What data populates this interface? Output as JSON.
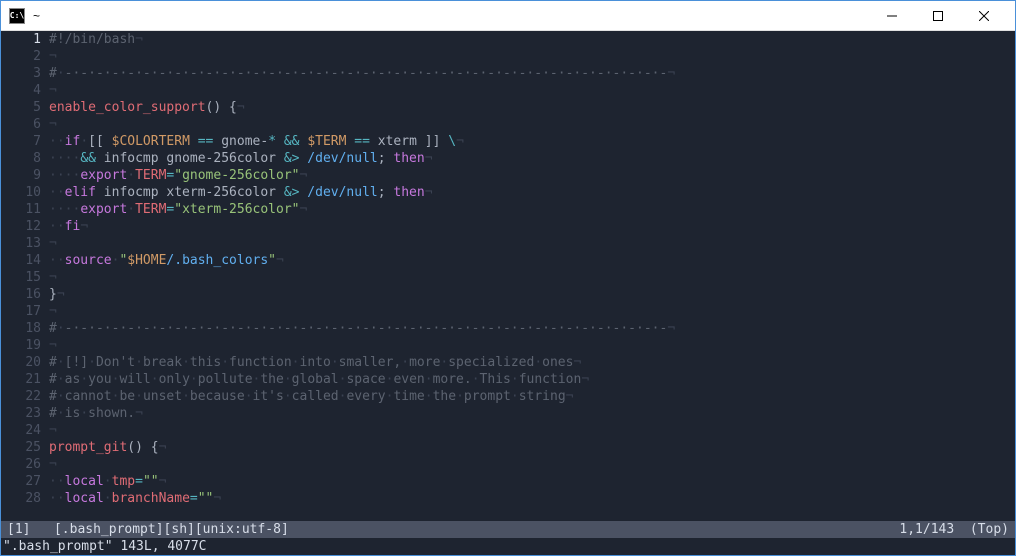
{
  "window": {
    "title": "~",
    "icon_label": "C:\\"
  },
  "gutter": {
    "current_line": 1,
    "total_visible": 28
  },
  "code": [
    [
      {
        "c": "comment",
        "t": "#!/bin/bash"
      },
      {
        "c": "ws",
        "t": "¬"
      }
    ],
    [
      {
        "c": "ws",
        "t": "¬"
      }
    ],
    [
      {
        "c": "comment",
        "t": "#"
      },
      {
        "c": "ws",
        "t": "·"
      },
      {
        "c": "comment",
        "t": "-·-·-·-·-·-·-·-·-·-·-·-·-·-·-·-·-·-·-·-·-·-·-·-·-·-·-·-·-·-·-·-·-·-·-·-·-·-·-"
      },
      {
        "c": "ws",
        "t": "¬"
      }
    ],
    [
      {
        "c": "ws",
        "t": "¬"
      }
    ],
    [
      {
        "c": "func",
        "t": "enable_color_support"
      },
      {
        "c": "punct",
        "t": "() {"
      },
      {
        "c": "ws",
        "t": "¬"
      }
    ],
    [
      {
        "c": "ws",
        "t": "¬"
      }
    ],
    [
      {
        "c": "ws",
        "t": "··"
      },
      {
        "c": "keyword",
        "t": "if"
      },
      {
        "c": "ws",
        "t": "·"
      },
      {
        "c": "punct",
        "t": "[[ "
      },
      {
        "c": "var",
        "t": "$COLORTERM"
      },
      {
        "c": "punct",
        "t": " "
      },
      {
        "c": "op",
        "t": "=="
      },
      {
        "c": "punct",
        "t": " gnome-"
      },
      {
        "c": "op",
        "t": "*"
      },
      {
        "c": "punct",
        "t": " "
      },
      {
        "c": "op",
        "t": "&&"
      },
      {
        "c": "punct",
        "t": " "
      },
      {
        "c": "var",
        "t": "$TERM"
      },
      {
        "c": "punct",
        "t": " "
      },
      {
        "c": "op",
        "t": "=="
      },
      {
        "c": "punct",
        "t": " xterm ]] "
      },
      {
        "c": "op",
        "t": "\\"
      },
      {
        "c": "ws",
        "t": "¬"
      }
    ],
    [
      {
        "c": "ws",
        "t": "····"
      },
      {
        "c": "op",
        "t": "&&"
      },
      {
        "c": "punct",
        "t": " infocmp gnome-256color "
      },
      {
        "c": "op",
        "t": "&>"
      },
      {
        "c": "punct",
        "t": " "
      },
      {
        "c": "path",
        "t": "/dev/null"
      },
      {
        "c": "punct",
        "t": "; "
      },
      {
        "c": "keyword",
        "t": "then"
      },
      {
        "c": "ws",
        "t": "¬"
      }
    ],
    [
      {
        "c": "ws",
        "t": "····"
      },
      {
        "c": "keyword",
        "t": "export"
      },
      {
        "c": "ws",
        "t": "·"
      },
      {
        "c": "builtin",
        "t": "TERM"
      },
      {
        "c": "op",
        "t": "="
      },
      {
        "c": "string",
        "t": "\"gnome-256color\""
      },
      {
        "c": "ws",
        "t": "¬"
      }
    ],
    [
      {
        "c": "ws",
        "t": "··"
      },
      {
        "c": "keyword",
        "t": "elif"
      },
      {
        "c": "punct",
        "t": " infocmp xterm-256color "
      },
      {
        "c": "op",
        "t": "&>"
      },
      {
        "c": "punct",
        "t": " "
      },
      {
        "c": "path",
        "t": "/dev/null"
      },
      {
        "c": "punct",
        "t": "; "
      },
      {
        "c": "keyword",
        "t": "then"
      },
      {
        "c": "ws",
        "t": "¬"
      }
    ],
    [
      {
        "c": "ws",
        "t": "····"
      },
      {
        "c": "keyword",
        "t": "export"
      },
      {
        "c": "ws",
        "t": "·"
      },
      {
        "c": "builtin",
        "t": "TERM"
      },
      {
        "c": "op",
        "t": "="
      },
      {
        "c": "string",
        "t": "\"xterm-256color\""
      },
      {
        "c": "ws",
        "t": "¬"
      }
    ],
    [
      {
        "c": "ws",
        "t": "··"
      },
      {
        "c": "keyword",
        "t": "fi"
      },
      {
        "c": "ws",
        "t": "¬"
      }
    ],
    [
      {
        "c": "ws",
        "t": "¬"
      }
    ],
    [
      {
        "c": "ws",
        "t": "··"
      },
      {
        "c": "keyword",
        "t": "source"
      },
      {
        "c": "ws",
        "t": "·"
      },
      {
        "c": "string",
        "t": "\""
      },
      {
        "c": "var",
        "t": "$HOME"
      },
      {
        "c": "path",
        "t": "/.bash_colors"
      },
      {
        "c": "string",
        "t": "\""
      },
      {
        "c": "ws",
        "t": "¬"
      }
    ],
    [
      {
        "c": "ws",
        "t": "¬"
      }
    ],
    [
      {
        "c": "punct",
        "t": "}"
      },
      {
        "c": "ws",
        "t": "¬"
      }
    ],
    [
      {
        "c": "ws",
        "t": "¬"
      }
    ],
    [
      {
        "c": "comment",
        "t": "#"
      },
      {
        "c": "ws",
        "t": "·"
      },
      {
        "c": "comment",
        "t": "-·-·-·-·-·-·-·-·-·-·-·-·-·-·-·-·-·-·-·-·-·-·-·-·-·-·-·-·-·-·-·-·-·-·-·-·-·-·-"
      },
      {
        "c": "ws",
        "t": "¬"
      }
    ],
    [
      {
        "c": "ws",
        "t": "¬"
      }
    ],
    [
      {
        "c": "comment",
        "t": "#"
      },
      {
        "c": "ws",
        "t": "·"
      },
      {
        "c": "comment",
        "t": "[!]"
      },
      {
        "c": "ws",
        "t": "·"
      },
      {
        "c": "comment",
        "t": "Don't"
      },
      {
        "c": "ws",
        "t": "·"
      },
      {
        "c": "comment",
        "t": "break"
      },
      {
        "c": "ws",
        "t": "·"
      },
      {
        "c": "comment",
        "t": "this"
      },
      {
        "c": "ws",
        "t": "·"
      },
      {
        "c": "comment",
        "t": "function"
      },
      {
        "c": "ws",
        "t": "·"
      },
      {
        "c": "comment",
        "t": "into"
      },
      {
        "c": "ws",
        "t": "·"
      },
      {
        "c": "comment",
        "t": "smaller,"
      },
      {
        "c": "ws",
        "t": "·"
      },
      {
        "c": "comment",
        "t": "more"
      },
      {
        "c": "ws",
        "t": "·"
      },
      {
        "c": "comment",
        "t": "specialized"
      },
      {
        "c": "ws",
        "t": "·"
      },
      {
        "c": "comment",
        "t": "ones"
      },
      {
        "c": "ws",
        "t": "¬"
      }
    ],
    [
      {
        "c": "comment",
        "t": "#"
      },
      {
        "c": "ws",
        "t": "·"
      },
      {
        "c": "comment",
        "t": "as"
      },
      {
        "c": "ws",
        "t": "·"
      },
      {
        "c": "comment",
        "t": "you"
      },
      {
        "c": "ws",
        "t": "·"
      },
      {
        "c": "comment",
        "t": "will"
      },
      {
        "c": "ws",
        "t": "·"
      },
      {
        "c": "comment",
        "t": "only"
      },
      {
        "c": "ws",
        "t": "·"
      },
      {
        "c": "comment",
        "t": "pollute"
      },
      {
        "c": "ws",
        "t": "·"
      },
      {
        "c": "comment",
        "t": "the"
      },
      {
        "c": "ws",
        "t": "·"
      },
      {
        "c": "comment",
        "t": "global"
      },
      {
        "c": "ws",
        "t": "·"
      },
      {
        "c": "comment",
        "t": "space"
      },
      {
        "c": "ws",
        "t": "·"
      },
      {
        "c": "comment",
        "t": "even"
      },
      {
        "c": "ws",
        "t": "·"
      },
      {
        "c": "comment",
        "t": "more."
      },
      {
        "c": "ws",
        "t": "·"
      },
      {
        "c": "comment",
        "t": "This"
      },
      {
        "c": "ws",
        "t": "·"
      },
      {
        "c": "comment",
        "t": "function"
      },
      {
        "c": "ws",
        "t": "¬"
      }
    ],
    [
      {
        "c": "comment",
        "t": "#"
      },
      {
        "c": "ws",
        "t": "·"
      },
      {
        "c": "comment",
        "t": "cannot"
      },
      {
        "c": "ws",
        "t": "·"
      },
      {
        "c": "comment",
        "t": "be"
      },
      {
        "c": "ws",
        "t": "·"
      },
      {
        "c": "comment",
        "t": "unset"
      },
      {
        "c": "ws",
        "t": "·"
      },
      {
        "c": "comment",
        "t": "because"
      },
      {
        "c": "ws",
        "t": "·"
      },
      {
        "c": "comment",
        "t": "it's"
      },
      {
        "c": "ws",
        "t": "·"
      },
      {
        "c": "comment",
        "t": "called"
      },
      {
        "c": "ws",
        "t": "·"
      },
      {
        "c": "comment",
        "t": "every"
      },
      {
        "c": "ws",
        "t": "·"
      },
      {
        "c": "comment",
        "t": "time"
      },
      {
        "c": "ws",
        "t": "·"
      },
      {
        "c": "comment",
        "t": "the"
      },
      {
        "c": "ws",
        "t": "·"
      },
      {
        "c": "comment",
        "t": "prompt"
      },
      {
        "c": "ws",
        "t": "·"
      },
      {
        "c": "comment",
        "t": "string"
      },
      {
        "c": "ws",
        "t": "¬"
      }
    ],
    [
      {
        "c": "comment",
        "t": "#"
      },
      {
        "c": "ws",
        "t": "·"
      },
      {
        "c": "comment",
        "t": "is"
      },
      {
        "c": "ws",
        "t": "·"
      },
      {
        "c": "comment",
        "t": "shown."
      },
      {
        "c": "ws",
        "t": "¬"
      }
    ],
    [
      {
        "c": "ws",
        "t": "¬"
      }
    ],
    [
      {
        "c": "func",
        "t": "prompt_git"
      },
      {
        "c": "punct",
        "t": "() {"
      },
      {
        "c": "ws",
        "t": "¬"
      }
    ],
    [
      {
        "c": "ws",
        "t": "¬"
      }
    ],
    [
      {
        "c": "ws",
        "t": "··"
      },
      {
        "c": "keyword",
        "t": "local"
      },
      {
        "c": "ws",
        "t": "·"
      },
      {
        "c": "builtin",
        "t": "tmp"
      },
      {
        "c": "op",
        "t": "="
      },
      {
        "c": "string",
        "t": "\"\""
      },
      {
        "c": "ws",
        "t": "¬"
      }
    ],
    [
      {
        "c": "ws",
        "t": "··"
      },
      {
        "c": "keyword",
        "t": "local"
      },
      {
        "c": "ws",
        "t": "·"
      },
      {
        "c": "builtin",
        "t": "branchName"
      },
      {
        "c": "op",
        "t": "="
      },
      {
        "c": "string",
        "t": "\"\""
      },
      {
        "c": "ws",
        "t": "¬"
      }
    ]
  ],
  "statusline": {
    "buffer_num": "[1]",
    "filename": "[.bash_prompt]",
    "filetype": "[sh]",
    "encoding": "[unix:utf-8]",
    "position": "1,1/143",
    "scroll": "(Top)"
  },
  "cmdline": {
    "text": "\".bash_prompt\" 143L, 4077C"
  }
}
